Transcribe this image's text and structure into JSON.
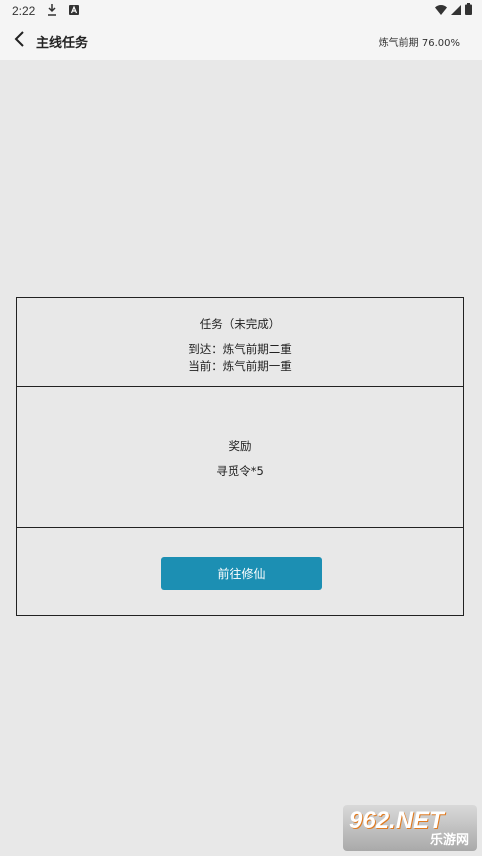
{
  "status": {
    "time": "2:22"
  },
  "header": {
    "title": "主线任务",
    "progress": "炼气前期 76.00%"
  },
  "task": {
    "heading": "任务（未完成）",
    "target": "到达：炼气前期二重",
    "current": "当前：炼气前期一重"
  },
  "reward": {
    "heading": "奖励",
    "item": "寻觅令*5"
  },
  "action": {
    "button_label": "前往修仙"
  },
  "watermark": {
    "logo": "962.NET",
    "sub": "乐游网"
  },
  "colors": {
    "accent": "#1c8fb3",
    "background": "#e8e8e8",
    "bar": "#f5f5f5"
  }
}
